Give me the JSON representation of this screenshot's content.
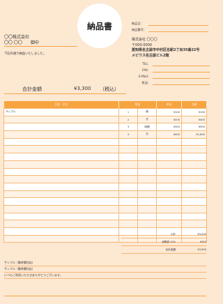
{
  "document": {
    "title": "納品書",
    "meta": [
      {
        "label": "納品日：",
        "value": ""
      },
      {
        "label": "納品番号：",
        "value": ""
      }
    ],
    "client": {
      "name": "〇〇株式会社",
      "person": "〇〇 〇〇",
      "honorific": "御中"
    },
    "intro": "下記の通り納品いたしました。",
    "company": {
      "name": "株式会社 〇〇〇",
      "postal": "〒000-0000",
      "address1": "愛知県名古屋市中村区名駅2丁目35番22号",
      "address2": "メビウス名古屋ビル2階"
    },
    "contacts": [
      {
        "label": "TEL：",
        "value": ""
      },
      {
        "label": "FAX：",
        "value": ""
      },
      {
        "label": "E-Mail：",
        "value": ""
      },
      {
        "label": "担当：",
        "value": ""
      }
    ],
    "total": {
      "label": "合計金額",
      "amount": "¥3,300",
      "tax_note": "（税込）"
    }
  },
  "table": {
    "headers": [
      "品番・品名",
      "数量",
      "",
      "単価",
      "金額"
    ],
    "rows": [
      [
        "サンプル",
        "1",
        "個",
        "¥100",
        "¥100"
      ],
      [
        "",
        "2",
        "式",
        "¥200",
        "¥400"
      ],
      [
        "",
        "3",
        "時間",
        "¥300",
        "¥900"
      ],
      [
        "",
        "4",
        "日",
        "¥400",
        "¥1,600"
      ],
      [
        "",
        "",
        "",
        "",
        ""
      ],
      [
        "",
        "",
        "",
        "",
        ""
      ],
      [
        "",
        "",
        "",
        "",
        ""
      ],
      [
        "",
        "",
        "",
        "",
        ""
      ],
      [
        "",
        "",
        "",
        "",
        ""
      ],
      [
        "",
        "",
        "",
        "",
        ""
      ],
      [
        "",
        "",
        "",
        "",
        ""
      ],
      [
        "",
        "",
        "",
        "",
        ""
      ],
      [
        "",
        "",
        "",
        "",
        ""
      ],
      [
        "",
        "",
        "",
        "",
        ""
      ],
      [
        "",
        "",
        "",
        "",
        ""
      ],
      [
        "",
        "",
        "",
        "",
        ""
      ],
      [
        "",
        "",
        "",
        "",
        ""
      ],
      [
        "",
        "",
        "",
        "",
        ""
      ]
    ]
  },
  "summary": [
    {
      "label": "小計",
      "value": "¥3,000"
    },
    {
      "label": "消費税 10%",
      "value": "¥300"
    },
    {
      "label": "合計金額",
      "value": "¥3,300"
    }
  ],
  "notes": [
    "サンプル（備考欄対応）",
    "サンプル（備考欄対応）",
    "いつもご利用いただきありがとうございます。"
  ],
  "colors": {
    "accent": "#f7a43f",
    "background": "#fde8d2"
  }
}
